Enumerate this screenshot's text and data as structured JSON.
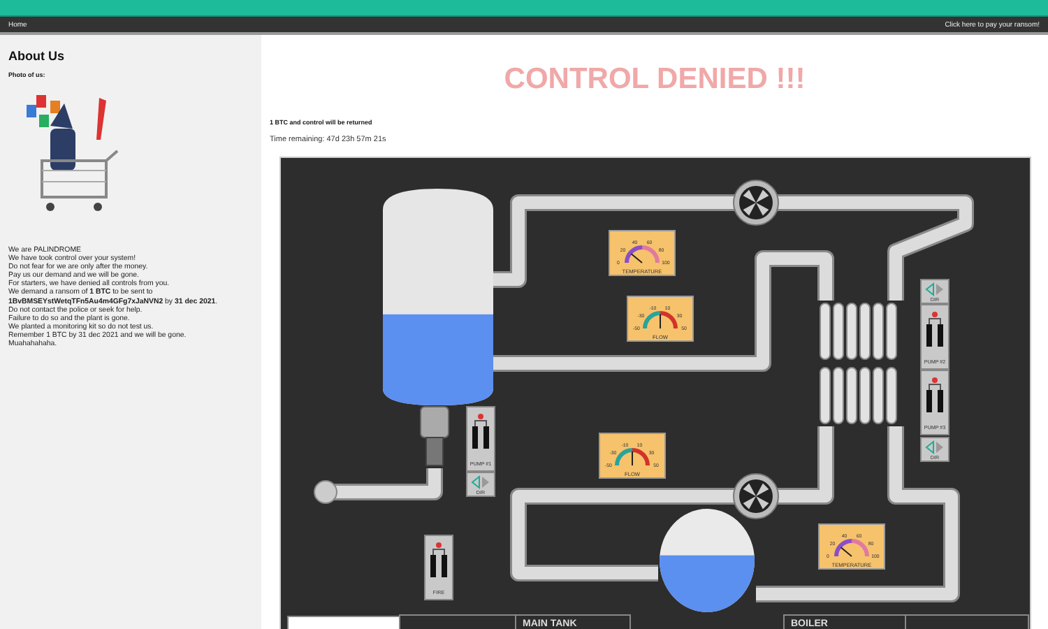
{
  "nav": {
    "home": "Home",
    "pay_link": "Click here to pay your ransom!"
  },
  "sidebar": {
    "title": "About Us",
    "photo_caption": "Photo of us:",
    "message_lines": [
      "We are PALINDROME",
      "We have took control over your system!",
      "Do not fear for we are only after the money.",
      "Pay us our demand and we will be gone.",
      "For starters, we have denied all controls from you.",
      "We demand a ransom of **1 BTC** to be sent to",
      "**1BvBMSEYstWetqTFn5Au4m4GFg7xJaNVN2** by **31 dec 2021**.",
      "Do not contact the police or seek for help.",
      "Failure to do so and the plant is gone.",
      "We planted a monitoring kit so do not test us.",
      "Remember 1 BTC by 31 dec 2021 and we will be gone.",
      "Muahahahaha."
    ]
  },
  "main": {
    "headline": "CONTROL DENIED !!!",
    "subtitle": "1 BTC and control will be returned",
    "timer": "Time remaining: 47d 23h 57m 21s"
  },
  "hmi": {
    "tank": {
      "level": 0.42
    },
    "boiler": {
      "level": 0.55
    },
    "gauges": [
      {
        "kind": "temperature",
        "label": "TEMPERATURE",
        "ticks": [
          "0",
          "20",
          "40",
          "60",
          "80",
          "100"
        ]
      },
      {
        "kind": "flow",
        "label": "FLOW",
        "ticks": [
          "-50",
          "-30",
          "-10",
          "10",
          "30",
          "50"
        ]
      },
      {
        "kind": "flow",
        "label": "FLOW",
        "ticks": [
          "-50",
          "-30",
          "-10",
          "10",
          "30",
          "50"
        ]
      },
      {
        "kind": "temperature",
        "label": "TEMPERATURE",
        "ticks": [
          "0",
          "20",
          "40",
          "60",
          "80",
          "100"
        ]
      }
    ],
    "switches": [
      {
        "label": "PUMP #1"
      },
      {
        "label": "FIRE"
      },
      {
        "label": "PUMP #2"
      },
      {
        "label": "PUMP #3"
      }
    ],
    "dir_controls": [
      "DIR",
      "DIR",
      "DIR"
    ],
    "table_headers": [
      "MAIN TANK",
      "BOILER"
    ]
  }
}
